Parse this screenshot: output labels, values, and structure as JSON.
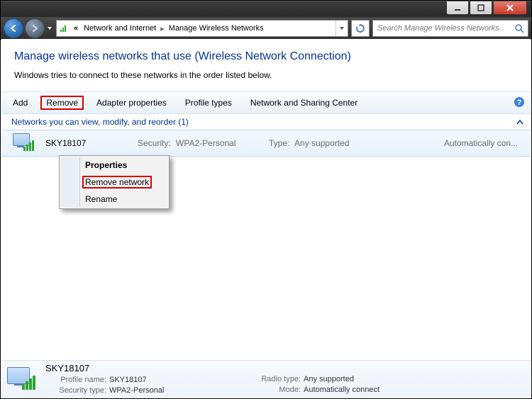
{
  "titlebar": {},
  "nav": {
    "breadcrumb": {
      "seg1": "Network and Internet",
      "seg2": "Manage Wireless Networks"
    },
    "search_placeholder": "Search Manage Wireless Networks"
  },
  "page": {
    "title": "Manage wireless networks that use (Wireless Network Connection)",
    "description": "Windows tries to connect to these networks in the order listed below."
  },
  "toolbar": {
    "add": "Add",
    "remove": "Remove",
    "adapter": "Adapter properties",
    "profile": "Profile types",
    "sharing": "Network and Sharing Center"
  },
  "group": {
    "label": "Networks you can view, modify, and reorder (1)"
  },
  "network": {
    "name": "SKY18107",
    "security_label": "Security:",
    "security_value": "WPA2-Personal",
    "type_label": "Type:",
    "type_value": "Any supported",
    "auto": "Automatically con..."
  },
  "context_menu": {
    "properties": "Properties",
    "remove": "Remove network",
    "rename": "Rename"
  },
  "details": {
    "name": "SKY18107",
    "profile_label": "Profile name:",
    "profile_value": "SKY18107",
    "security_label": "Security type:",
    "security_value": "WPA2-Personal",
    "radio_label": "Radio type:",
    "radio_value": "Any supported",
    "mode_label": "Mode:",
    "mode_value": "Automatically connect"
  }
}
